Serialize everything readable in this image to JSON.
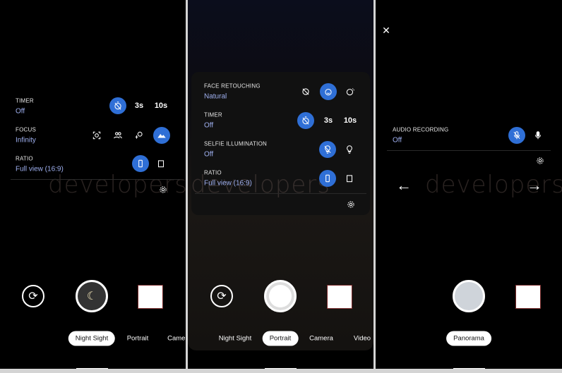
{
  "watermark": "developers",
  "accent": "#2f6fd6",
  "panel1": {
    "settings": [
      {
        "label": "TIMER",
        "value": "Off",
        "options": [
          "timer-off",
          "3s",
          "10s"
        ],
        "selected": 0
      },
      {
        "label": "FOCUS",
        "value": "Infinity",
        "options": [
          "auto-focus",
          "near-people",
          "far-landscape",
          "infinity"
        ],
        "selected": 3
      },
      {
        "label": "RATIO",
        "value": "Full view (16:9)",
        "options": [
          "full-view",
          "4:3"
        ],
        "selected": 0
      }
    ],
    "modes": [
      "Night Sight",
      "Portrait",
      "Camera"
    ],
    "active_mode": "Night Sight"
  },
  "panel2": {
    "settings": [
      {
        "label": "FACE RETOUCHING",
        "value": "Natural",
        "options": [
          "off",
          "natural",
          "smooth"
        ],
        "selected": 1
      },
      {
        "label": "TIMER",
        "value": "Off",
        "options": [
          "timer-off",
          "3s",
          "10s"
        ],
        "selected": 0
      },
      {
        "label": "SELFIE ILLUMINATION",
        "value": "Off",
        "options": [
          "off",
          "on"
        ],
        "selected": 0
      },
      {
        "label": "RATIO",
        "value": "Full view (16:9)",
        "options": [
          "full-view",
          "4:3"
        ],
        "selected": 0
      }
    ],
    "modes": [
      "Night Sight",
      "Portrait",
      "Camera",
      "Video"
    ],
    "active_mode": "Portrait"
  },
  "panel3": {
    "settings": [
      {
        "label": "AUDIO RECORDING",
        "value": "Off",
        "options": [
          "mic-off",
          "mic-on"
        ],
        "selected": 0
      }
    ],
    "modes": [
      "Panorama"
    ],
    "active_mode": "Panorama"
  },
  "timer_labels": {
    "three": "3s",
    "ten": "10s"
  }
}
